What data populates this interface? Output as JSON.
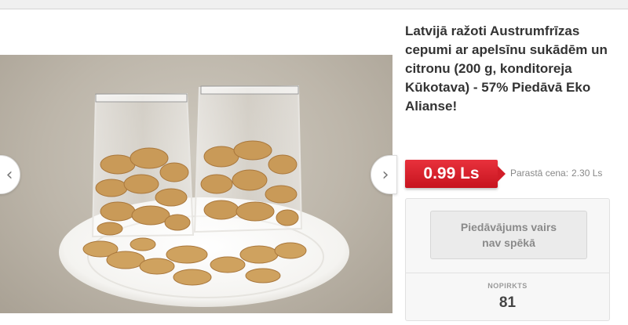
{
  "product": {
    "title": "Latvijā ražoti Austrumfrīzas cepumi ar apelsīnu sukādēm un citronu (200 g, konditoreja Kūkotava) - 57% Piedāvā Eko Alianse!",
    "image_alt": "Cepumi caurspīdīgos maisiņos uz balta šķīvja"
  },
  "pricing": {
    "price": "0.99 Ls",
    "original_label": "Parastā cena:",
    "original_value": "2.30 Ls"
  },
  "deal": {
    "status_button": "Piedāvājums vairs nav spēkā",
    "bought_label": "NOPIRKTS",
    "bought_count": "81"
  },
  "gallery": {
    "prev_icon": "‹",
    "next_icon": "›"
  },
  "colors": {
    "price_red": "#d21d28",
    "title_text": "#333333"
  }
}
